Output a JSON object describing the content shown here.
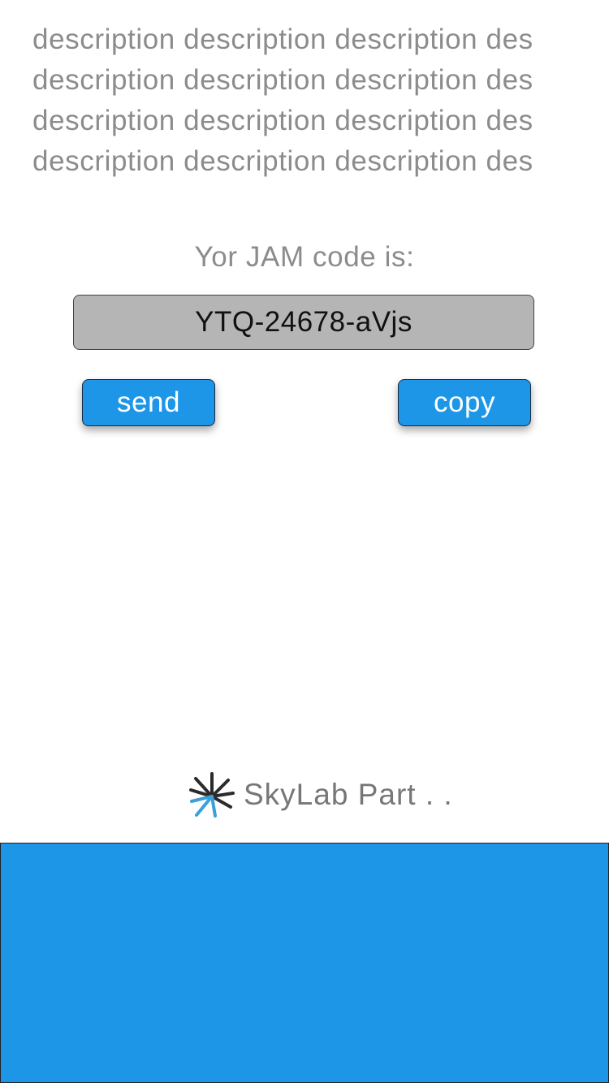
{
  "description": {
    "lines": [
      "description description description des",
      "description description description des",
      "description description description des",
      "description description description des"
    ]
  },
  "code": {
    "label": "Yor JAM code is:",
    "value": "YTQ-24678-aVjs"
  },
  "actions": {
    "send_label": "send",
    "copy_label": "copy"
  },
  "brand": {
    "name": "SkyLab Part . .",
    "logo_icon": "skylab-starburst-icon"
  },
  "colors": {
    "accent": "#1e96e8",
    "code_field_bg": "#b5b5b5",
    "muted_text": "#8c8c8c",
    "logo_dark": "#2b2b2b",
    "logo_blue": "#3aa0d8"
  }
}
